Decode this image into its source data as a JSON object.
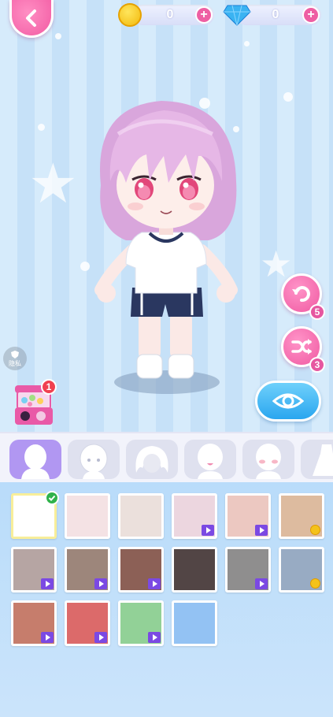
{
  "currency": {
    "coins": "0",
    "gems": "0",
    "coin_icon": "gold-coin-icon",
    "gem_icon": "blue-diamond-icon"
  },
  "buttons": {
    "undo_count": "5",
    "random_count": "3",
    "gacha_count": "1",
    "privacy_label": "隐私"
  },
  "icons": {
    "back": "chevron-left-icon",
    "undo": "undo-icon",
    "random": "shuffle-icon",
    "preview": "eye-icon"
  },
  "tabs": [
    {
      "name": "skin",
      "active": true
    },
    {
      "name": "face",
      "active": false
    },
    {
      "name": "hair",
      "active": false
    },
    {
      "name": "mouth",
      "active": false
    },
    {
      "name": "blush",
      "active": false
    },
    {
      "name": "dress",
      "active": false
    }
  ],
  "swatches": [
    {
      "color": "#ffffff",
      "badge": "check"
    },
    {
      "color": "#f4e2e4",
      "badge": "none"
    },
    {
      "color": "#ebe0dc",
      "badge": "none"
    },
    {
      "color": "#ecd6df",
      "badge": "play"
    },
    {
      "color": "#ecc8c1",
      "badge": "play"
    },
    {
      "color": "#ddbb9f",
      "badge": "coin"
    },
    {
      "color": "#b6a5a3",
      "badge": "play"
    },
    {
      "color": "#9d867b",
      "badge": "play"
    },
    {
      "color": "#8c6056",
      "badge": "play"
    },
    {
      "color": "#524545",
      "badge": "none"
    },
    {
      "color": "#8f8e8e",
      "badge": "play"
    },
    {
      "color": "#98abc3",
      "badge": "coin"
    },
    {
      "color": "#c67d6c",
      "badge": "play"
    },
    {
      "color": "#dc6a6a",
      "badge": "play"
    },
    {
      "color": "#92d197",
      "badge": "play"
    },
    {
      "color": "#93c2f3",
      "badge": "none"
    }
  ]
}
